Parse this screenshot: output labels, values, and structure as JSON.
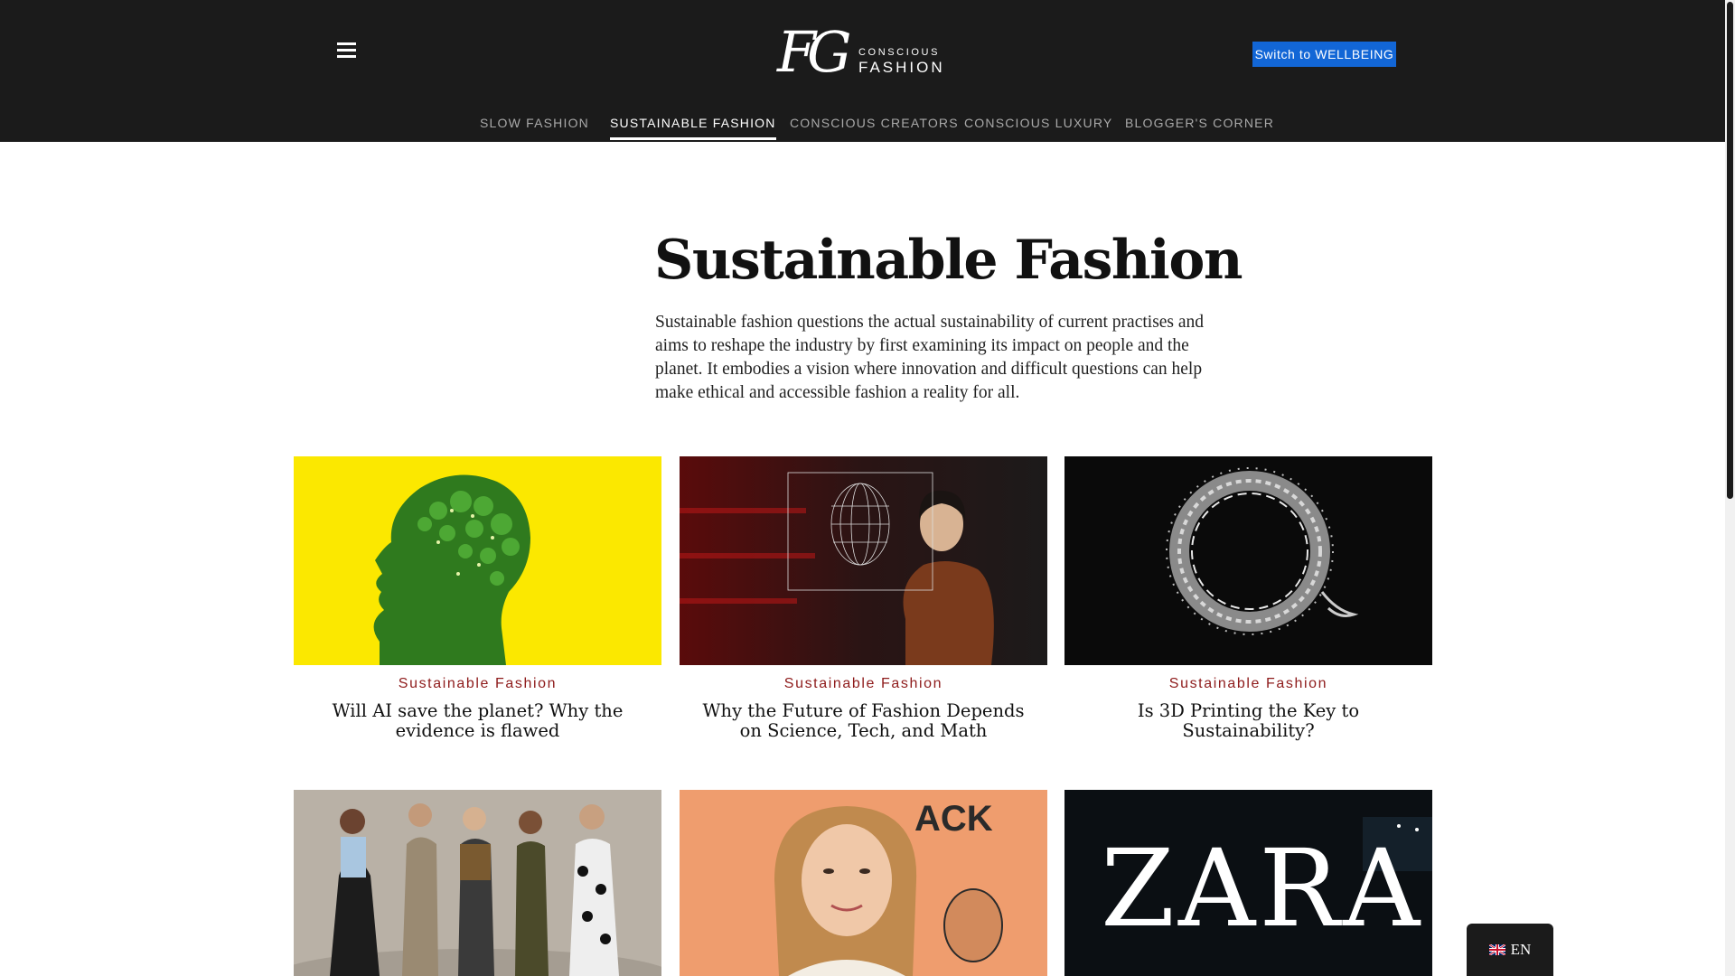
{
  "header": {
    "logo": {
      "monogram": "FG",
      "line1": "CONSCIOUS",
      "line2": "FASHION"
    },
    "switch_button": "Switch to WELLBEING",
    "nav": [
      {
        "label": "SLOW FASHION",
        "active": false
      },
      {
        "label": "SUSTAINABLE FASHION",
        "active": true
      },
      {
        "label": "CONSCIOUS CREATORS",
        "active": false
      },
      {
        "label": "CONSCIOUS LUXURY",
        "active": false
      },
      {
        "label": "BLOGGER'S CORNER",
        "active": false
      }
    ]
  },
  "main": {
    "title": "Sustainable Fashion",
    "intro": "Sustainable fashion questions the actual sustainability of current practises and aims to reshape the industry by first examining its impact on people and the planet. It embodies a vision where innovation and difficult questions can help make ethical and accessible fashion a reality for all.",
    "articles": [
      {
        "category": "Sustainable Fashion",
        "title": "Will AI save the planet? Why the evidence is flawed",
        "image": "green-forest-head-silhouette-on-yellow"
      },
      {
        "category": "Sustainable Fashion",
        "title": "Why the Future of Fashion Depends on Science, Tech, and Math",
        "image": "woman-with-wireframe-face"
      },
      {
        "category": "Sustainable Fashion",
        "title": "Is 3D Printing the Key to Sustainability?",
        "image": "3d-printed-ring-sculpture"
      },
      {
        "image": "group-of-women-dancing"
      },
      {
        "image": "woman-portrait-on-orange"
      },
      {
        "image": "zara-store-sign-at-night",
        "sign_text": "ZARA"
      }
    ]
  },
  "language": {
    "code": "EN",
    "flag": "uk-flag-icon"
  },
  "colors": {
    "header_bg": "#1b1b1b",
    "accent_blue": "#1266d6",
    "category_red": "#8e1b1b"
  }
}
